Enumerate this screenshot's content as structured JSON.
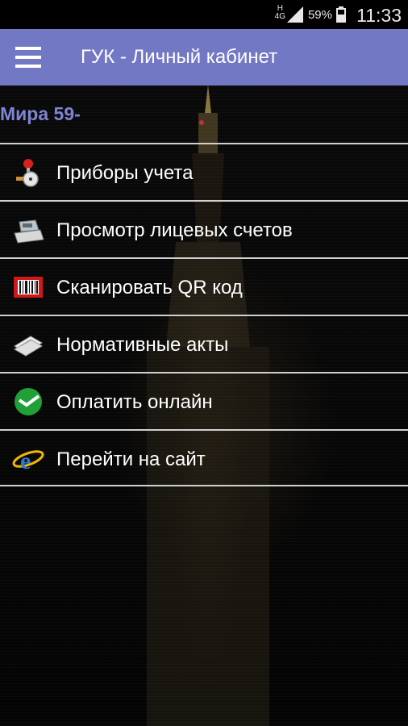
{
  "status_bar": {
    "network_top": "H",
    "network_bottom": "4G",
    "battery": "59%",
    "time": "11:33"
  },
  "app_bar": {
    "title": "ГУК - Личный кабинет"
  },
  "account": {
    "address": "Мира 59-"
  },
  "menu": {
    "items": [
      {
        "label": "Приборы учета",
        "icon": "meter-icon"
      },
      {
        "label": "Просмотр лицевых счетов",
        "icon": "cash-register-icon"
      },
      {
        "label": "Сканировать QR код",
        "icon": "barcode-scanner-icon"
      },
      {
        "label": "Нормативные акты",
        "icon": "documents-icon"
      },
      {
        "label": "Оплатить онлайн",
        "icon": "sberbank-icon"
      },
      {
        "label": "Перейти на сайт",
        "icon": "internet-explorer-icon"
      }
    ]
  },
  "colors": {
    "app_bar": "#7378c4",
    "address_text": "#7f84d2",
    "divider": "#d0d0d0"
  }
}
